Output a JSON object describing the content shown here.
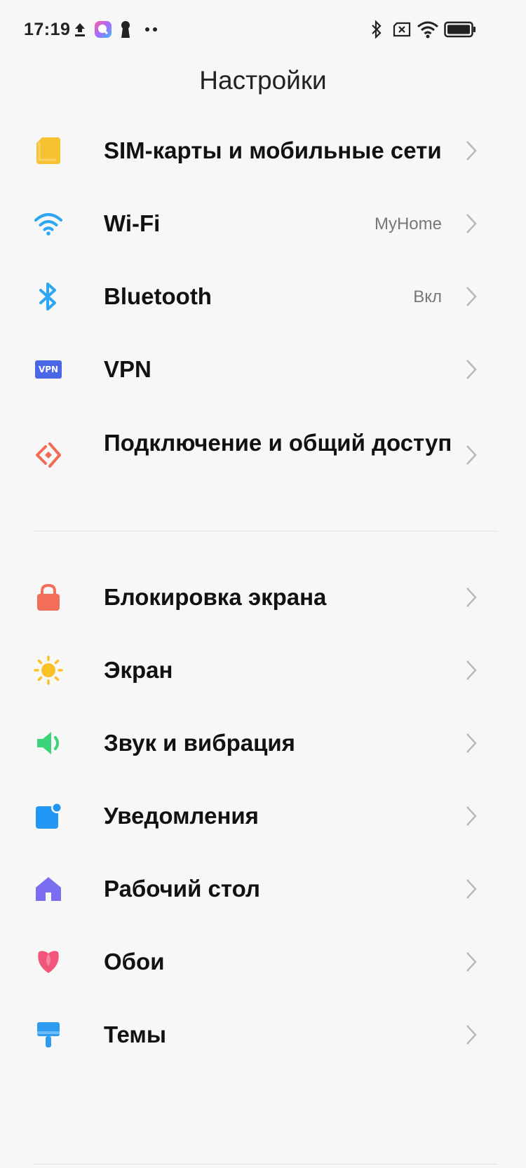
{
  "status_bar": {
    "time": "17:19",
    "icons": [
      "upload-icon",
      "app-notification-icon",
      "keyhole-icon",
      "more-dots-icon",
      "bluetooth-icon",
      "no-sim-icon",
      "wifi-icon",
      "battery-icon"
    ]
  },
  "header": {
    "title": "Настройки"
  },
  "colors": {
    "sim": "#f6c232",
    "wifi": "#2fa6f2",
    "bluetooth": "#2fa6f2",
    "vpn": "#4a67e6",
    "connection": "#f06c56",
    "lock": "#f46f5a",
    "display": "#f9c126",
    "sound": "#3dd27c",
    "notifications": "#2196f3",
    "home": "#7a6df0",
    "wallpaper": "#f1557a",
    "themes": "#2d9cf0",
    "chevron": "#b8b8b8"
  },
  "group1": [
    {
      "icon": "sim-card-icon",
      "label": "SIM-карты и мобильные сети",
      "value": ""
    },
    {
      "icon": "wifi-icon",
      "label": "Wi-Fi",
      "value": "MyHome"
    },
    {
      "icon": "bluetooth-icon",
      "label": "Bluetooth",
      "value": "Вкл"
    },
    {
      "icon": "vpn-icon",
      "label": "VPN",
      "value": "",
      "badge": "VPN"
    },
    {
      "icon": "connection-sharing-icon",
      "label": "Подключение и общий доступ",
      "value": ""
    }
  ],
  "group2": [
    {
      "icon": "lock-icon",
      "label": "Блокировка экрана",
      "value": ""
    },
    {
      "icon": "sun-icon",
      "label": "Экран",
      "value": ""
    },
    {
      "icon": "speaker-icon",
      "label": "Звук и вибрация",
      "value": ""
    },
    {
      "icon": "notification-icon",
      "label": "Уведомления",
      "value": ""
    },
    {
      "icon": "home-icon",
      "label": "Рабочий стол",
      "value": ""
    },
    {
      "icon": "flower-icon",
      "label": "Обои",
      "value": ""
    },
    {
      "icon": "brush-icon",
      "label": "Темы",
      "value": ""
    }
  ]
}
